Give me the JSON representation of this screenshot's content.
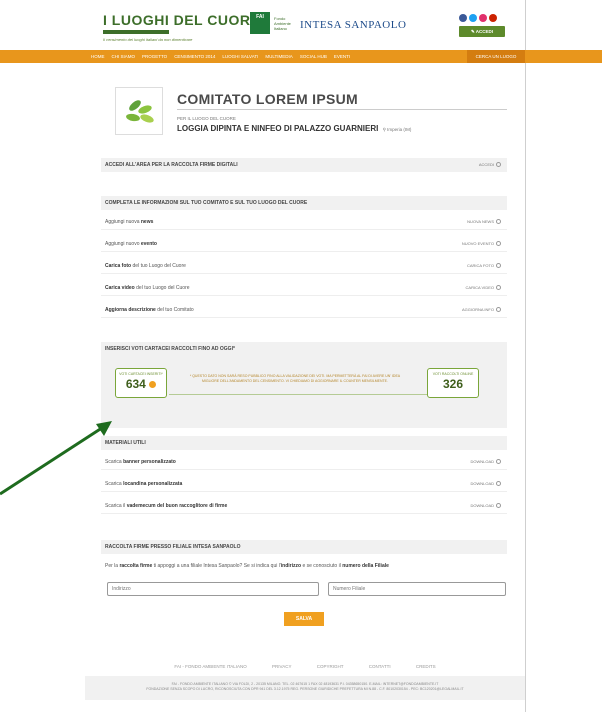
{
  "brand": {
    "title": "I LUOGHI DEL CUORE",
    "subtitle_bar": "UN PROGETTO DI",
    "tagline": "Il censimento dei luoghi italiani da non dimenticare",
    "fai_badge": "FAI",
    "fai_sub": "Fondo Ambiente Italiano",
    "partner": "INTESA SANPAOLO",
    "accedi_label": "ACCEDI"
  },
  "nav": {
    "items": [
      "HOME",
      "CHI SIAMO",
      "PROGETTO",
      "CENSIMENTO 2014",
      "LUOGHI SALVATI",
      "MULTIMEDIA",
      "SOCIAL HUB",
      "EVENTI"
    ],
    "cta": "CERCA UN LUOGO"
  },
  "committee": {
    "name": "COMITATO LOREM IPSUM",
    "per_label": "PER IL LUOGO DEL CUORE",
    "place": "LOGGIA DIPINTA E NINFEO DI PALAZZO GUARNIERI",
    "location": "Imperia (IM)"
  },
  "sections": {
    "firme_digitali": {
      "title": "ACCEDI ALL'AREA PER LA RACCOLTA FIRME DIGITALI",
      "action": "ACCEDI"
    },
    "completa": {
      "title": "COMPLETA LE INFORMAZIONI SUL TUO COMITATO E SUL TUO LUOGO DEL CUORE"
    },
    "voti": {
      "title": "INSERISCI VOTI CARTACEI RACCOLTI FINO AD OGGI*"
    },
    "materiali": {
      "title": "MATERIALI UTILI"
    },
    "filiale": {
      "title": "RACCOLTA FIRME PRESSO FILIALE INTESA SANPAOLO"
    }
  },
  "complete_rows": [
    {
      "pre": "Aggiungi nuova ",
      "bold": "news",
      "post": "",
      "action": "NUOVA NEWS"
    },
    {
      "pre": "Aggiungi nuovo ",
      "bold": "evento",
      "post": "",
      "action": "NUOVO EVENTO"
    },
    {
      "pre": "",
      "bold": "Carica foto",
      "post": " del tuo Luogo del Cuore",
      "action": "CARICA FOTO"
    },
    {
      "pre": "",
      "bold": "Carica video",
      "post": " del tuo Luogo del Cuore",
      "action": "CARICA VIDEO"
    },
    {
      "pre": "",
      "bold": "Aggiorna descrizione",
      "post": " del tuo Comitato",
      "action": "AGGIORNA INFO"
    }
  ],
  "votes": {
    "cartacei_label": "VOTI CARTACEI INSERITI*",
    "cartacei_value": "634",
    "note": "* QUESTO DATO NON SARÀ RESO PUBBLICO FINO ALLA VALIDAZIONE DEI VOTI. MA PERMETTERÀ AL FAI DI AVERE UN' IDEA MIGLIORE DELL'ANDAMENTO DEL CENSIMENTO. VI CHIEDIAMO DI AGGIORNARE IL COUNTER MENSILMENTE.",
    "online_label": "VOTI RACCOLTI ONLINE",
    "online_value": "326"
  },
  "materials": [
    {
      "pre": "Scarica ",
      "bold": "banner personalizzato",
      "post": "",
      "action": "DOWNLOAD"
    },
    {
      "pre": "Scarica ",
      "bold": "locandina personalizzata",
      "post": "",
      "action": "DOWNLOAD"
    },
    {
      "pre": "Scarica il ",
      "bold": "vademecum del buon raccoglitore di firme",
      "post": "",
      "action": "DOWNLOAD"
    }
  ],
  "filiale": {
    "question_pre": "Per la ",
    "question_bold1": "raccolta firme",
    "question_mid": " ti appoggi a una filiale Intesa Sanpaolo? Se si indica qui l'",
    "question_bold2": "indirizzo",
    "question_mid2": " e se conosciuto il ",
    "question_bold3": "numero della Filiale",
    "address_placeholder": "Indirizzo",
    "number_placeholder": "Numero Filiale",
    "save_label": "SALVA"
  },
  "footer": {
    "links": [
      "FAI - FONDO AMBIENTE ITALIANO",
      "PRIVACY",
      "COPYRIGHT",
      "CONTATTI",
      "CREDITS"
    ],
    "legal_line1": "FAI - FONDO AMBIENTE ITALIANO © VIA FOLDI, 2 - 20135 MILANO. TEL. 02 467615 1 FAX 02 48193631 P.I. 04358650150. E-MAIL: INTERNET@FONDOAMBIENTE.IT",
    "legal_line2": "FONDAZIONE SENZA SCOPO DI LUCRO, RICONOSCIUTA CON DPR 941 DEL 3.12.1975 REG. PERSONE GIURIDICHE PREFETTURA MI N.88 - C.F. 80102030154 - PEC: BC120201@LEGALMAIL.IT"
  },
  "colors": {
    "brand_green": "#3d6e2a",
    "nav_orange": "#e8961c",
    "vote_green": "#7aa63a",
    "arrow_green": "#1e6b1e",
    "salva_orange": "#f0a020"
  }
}
